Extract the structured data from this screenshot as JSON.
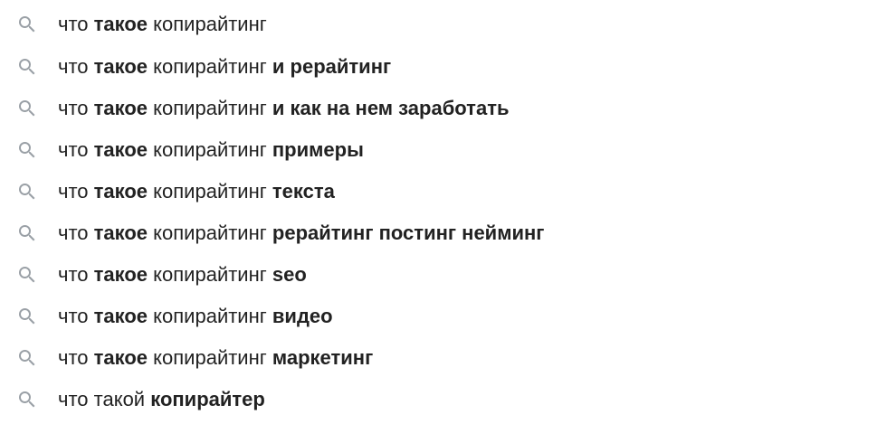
{
  "icon": "search-icon",
  "colors": {
    "text": "#222222",
    "icon": "#9aa0a6",
    "background": "#ffffff"
  },
  "suggestions": [
    [
      {
        "t": "что ",
        "b": false
      },
      {
        "t": "такое",
        "b": true
      },
      {
        "t": " копирайтинг",
        "b": false
      }
    ],
    [
      {
        "t": "что ",
        "b": false
      },
      {
        "t": "такое",
        "b": true
      },
      {
        "t": " копирайтинг ",
        "b": false
      },
      {
        "t": "и рерайтинг",
        "b": true
      }
    ],
    [
      {
        "t": "что ",
        "b": false
      },
      {
        "t": "такое",
        "b": true
      },
      {
        "t": " копирайтинг ",
        "b": false
      },
      {
        "t": "и как на нем заработать",
        "b": true
      }
    ],
    [
      {
        "t": "что ",
        "b": false
      },
      {
        "t": "такое",
        "b": true
      },
      {
        "t": " копирайтинг ",
        "b": false
      },
      {
        "t": "примеры",
        "b": true
      }
    ],
    [
      {
        "t": "что ",
        "b": false
      },
      {
        "t": "такое",
        "b": true
      },
      {
        "t": " копирайтинг ",
        "b": false
      },
      {
        "t": "текста",
        "b": true
      }
    ],
    [
      {
        "t": "что ",
        "b": false
      },
      {
        "t": "такое",
        "b": true
      },
      {
        "t": " копирайтинг ",
        "b": false
      },
      {
        "t": "рерайтинг постинг нейминг",
        "b": true
      }
    ],
    [
      {
        "t": "что ",
        "b": false
      },
      {
        "t": "такое",
        "b": true
      },
      {
        "t": " копирайтинг ",
        "b": false
      },
      {
        "t": "seo",
        "b": true
      }
    ],
    [
      {
        "t": "что ",
        "b": false
      },
      {
        "t": "такое",
        "b": true
      },
      {
        "t": " копирайтинг ",
        "b": false
      },
      {
        "t": "видео",
        "b": true
      }
    ],
    [
      {
        "t": "что ",
        "b": false
      },
      {
        "t": "такое",
        "b": true
      },
      {
        "t": " копирайтинг ",
        "b": false
      },
      {
        "t": "маркетинг",
        "b": true
      }
    ],
    [
      {
        "t": "что такой ",
        "b": false
      },
      {
        "t": "копирайтер",
        "b": true
      }
    ]
  ]
}
